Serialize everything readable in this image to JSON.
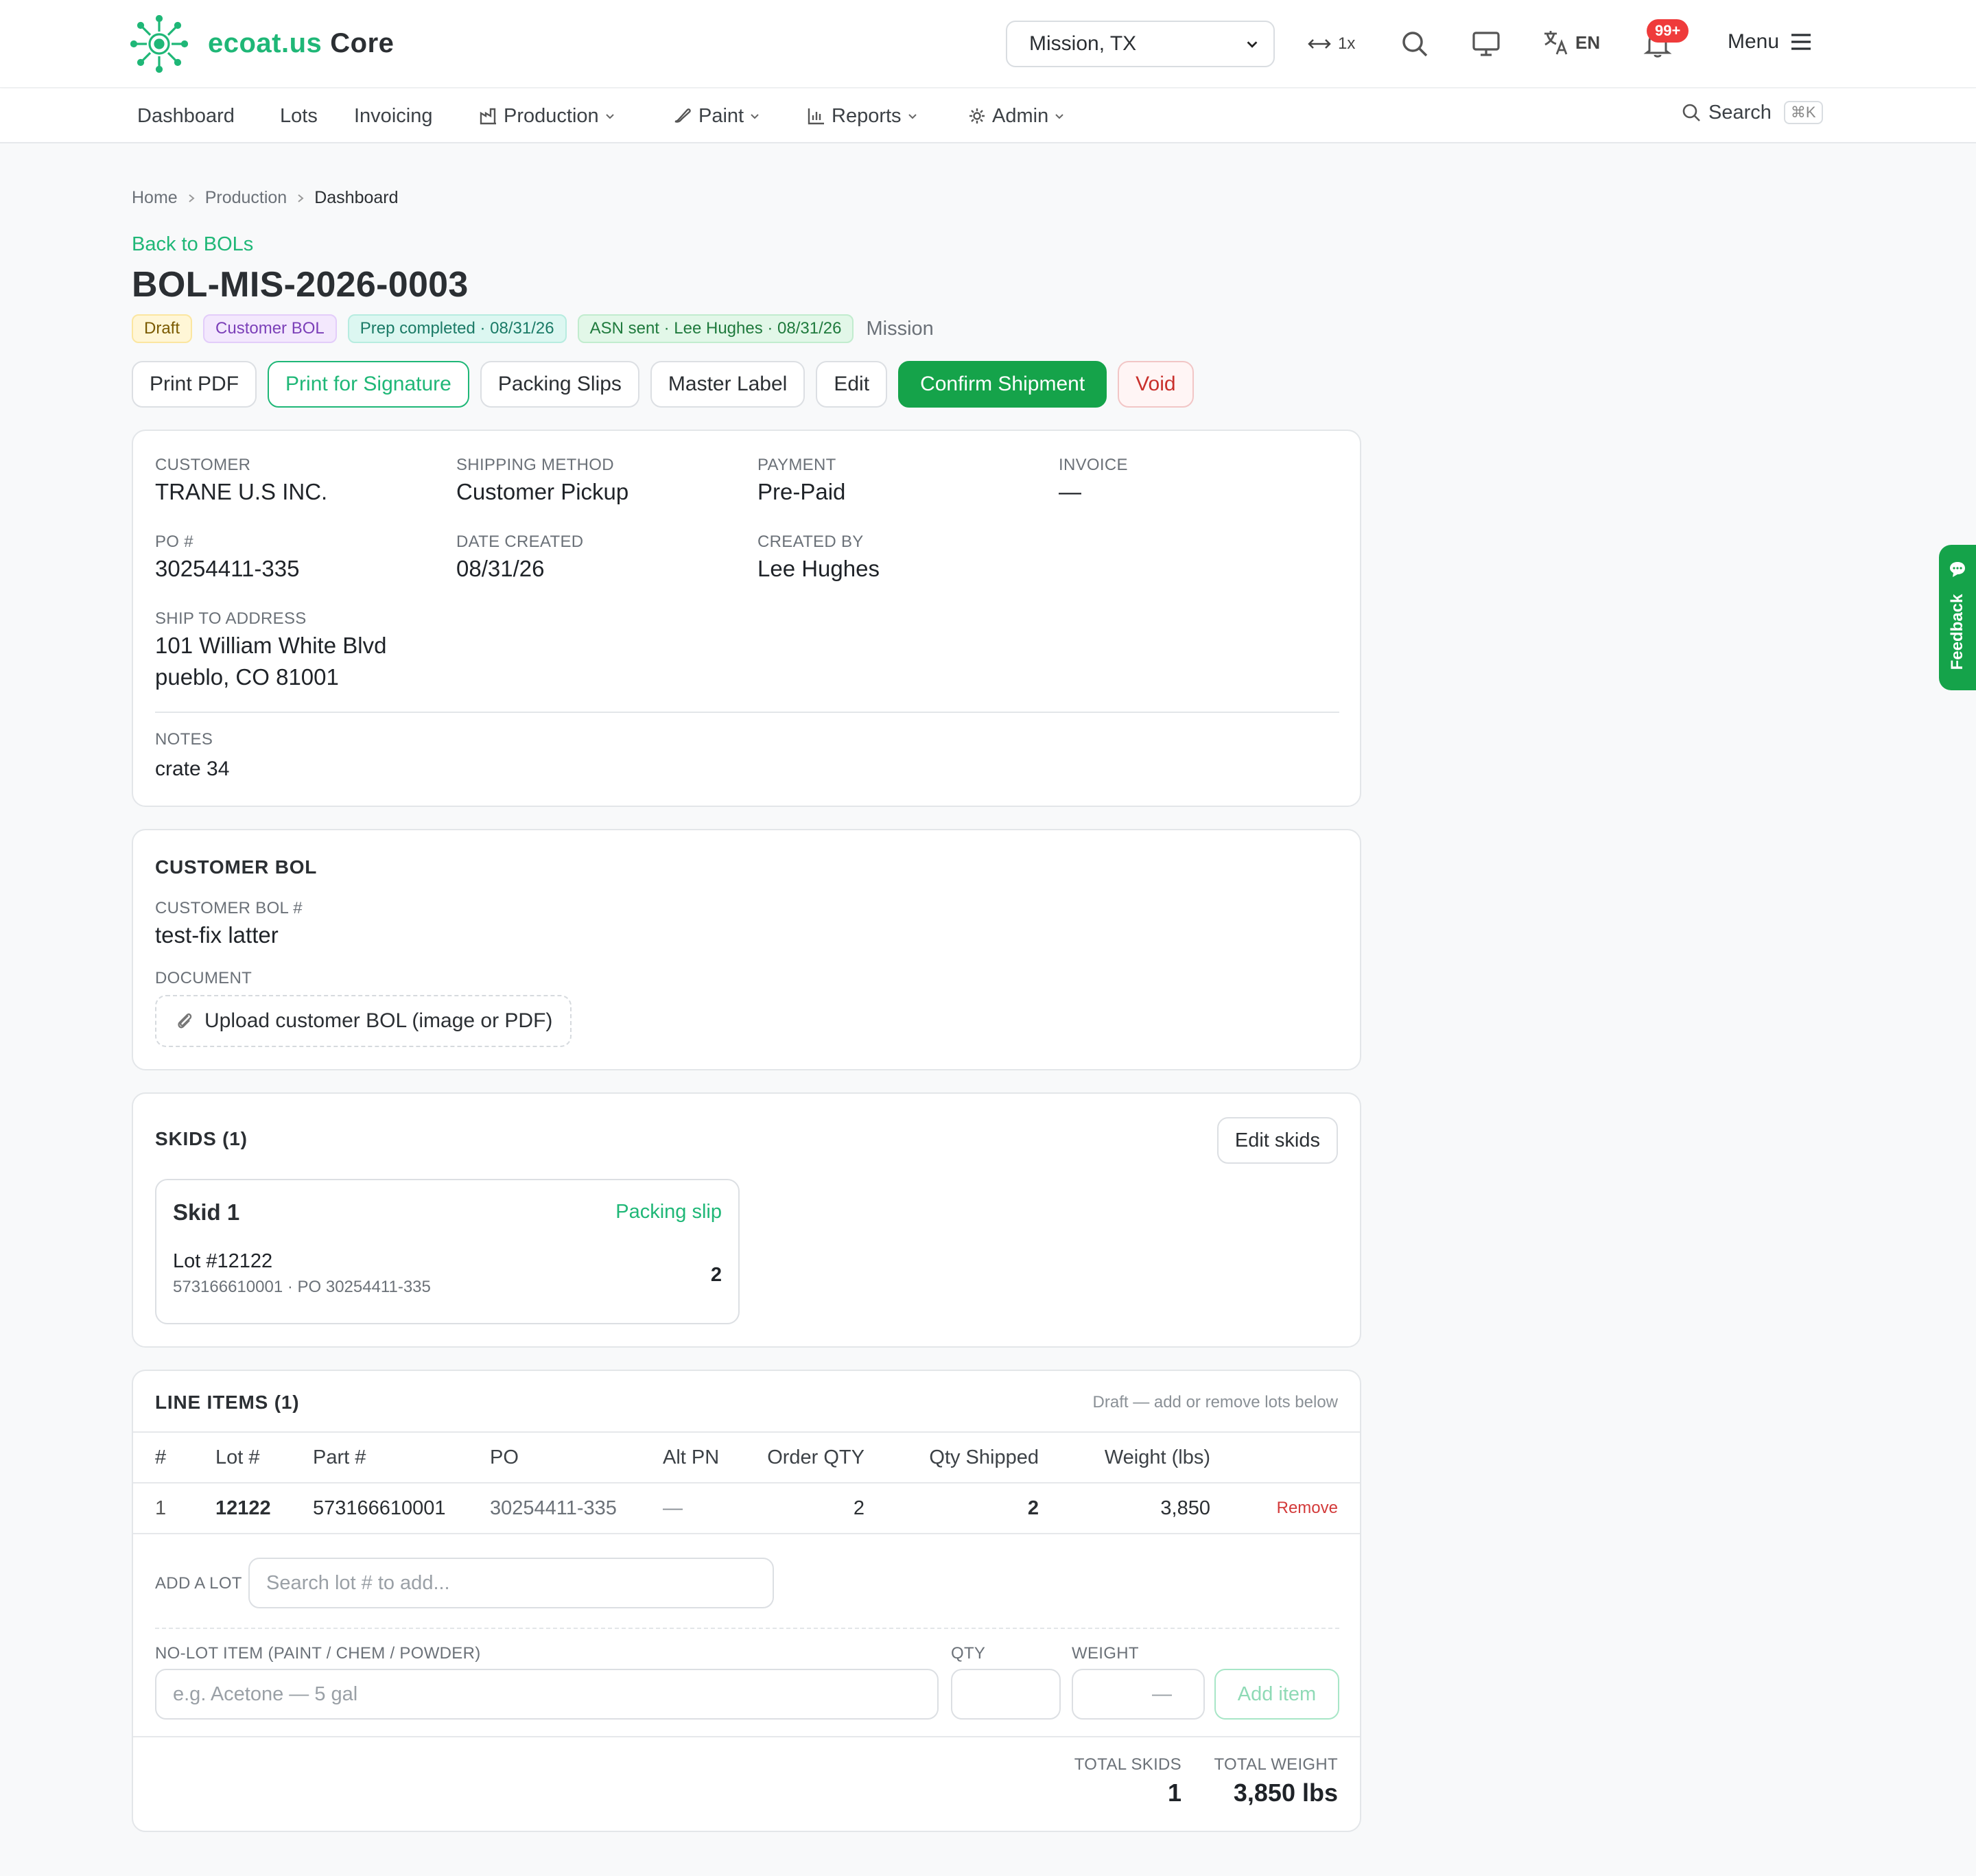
{
  "header": {
    "brand_accent": "ecoat.us",
    "brand_rest": "Core",
    "location": "Mission, TX",
    "zoom": "1x",
    "language": "EN",
    "notifications": "99+",
    "menu_label": "Menu",
    "colors": {
      "brand_green": "#1fb777",
      "action_green": "#15a34a",
      "alert_red": "#ef3b3b"
    }
  },
  "nav": {
    "items": [
      "Dashboard",
      "Lots",
      "Invoicing",
      "Production",
      "Paint",
      "Reports",
      "Admin"
    ],
    "search_label": "Search",
    "search_shortcut": "⌘K"
  },
  "breadcrumb": [
    "Home",
    "Production",
    "Dashboard"
  ],
  "back_link": "Back to BOLs",
  "title": "BOL-MIS-2026-0003",
  "badges": {
    "status": "Draft",
    "type": "Customer BOL",
    "prep": "Prep completed · 08/31/26",
    "asn": "ASN sent · Lee Hughes · 08/31/26",
    "site": "Mission"
  },
  "actions": [
    "Print PDF",
    "Print for Signature",
    "Packing Slips",
    "Master Label",
    "Edit",
    "Confirm Shipment",
    "Void"
  ],
  "details": {
    "customer_label": "CUSTOMER",
    "customer": "TRANE U.S INC.",
    "shipping_label": "SHIPPING METHOD",
    "shipping": "Customer Pickup",
    "payment_label": "PAYMENT",
    "payment": "Pre-Paid",
    "invoice_label": "INVOICE",
    "invoice": "—",
    "po_label": "PO #",
    "po": "30254411-335",
    "date_label": "DATE CREATED",
    "date": "08/31/26",
    "createdby_label": "CREATED BY",
    "createdby": "Lee Hughes",
    "shipto_label": "SHIP TO ADDRESS",
    "shipto_line1": "101 William White Blvd",
    "shipto_line2": "pueblo, CO 81001",
    "notes_label": "NOTES",
    "notes": "crate 34"
  },
  "customer_bol": {
    "title": "CUSTOMER BOL",
    "number_label": "CUSTOMER BOL #",
    "number": "test-fix latter",
    "document_label": "DOCUMENT",
    "upload_label": "Upload customer BOL (image or PDF)"
  },
  "skids": {
    "title": "SKIDS (1)",
    "edit_label": "Edit skids",
    "items": [
      {
        "name": "Skid 1",
        "link": "Packing slip",
        "lot": "Lot #12122",
        "sub": "573166610001 · PO 30254411-335",
        "qty": "2"
      }
    ]
  },
  "line_items": {
    "title": "LINE ITEMS (1)",
    "hint": "Draft — add or remove lots below",
    "columns": [
      "#",
      "Lot #",
      "Part #",
      "PO",
      "Alt PN",
      "Order QTY",
      "Qty Shipped",
      "Weight (lbs)"
    ],
    "rows": [
      {
        "n": "1",
        "lot": "12122",
        "part": "573166610001",
        "po": "30254411-335",
        "alt": "—",
        "order_qty": "2",
        "qty_shipped": "2",
        "weight": "3,850",
        "action": "Remove"
      }
    ],
    "add_lot_label": "ADD A LOT",
    "add_lot_placeholder": "Search lot # to add...",
    "nolot_label": "NO-LOT ITEM (PAINT / CHEM / POWDER)",
    "nolot_placeholder": "e.g. Acetone — 5 gal",
    "qty_label": "QTY",
    "weight_label": "WEIGHT",
    "weight_placeholder": "—",
    "add_item_label": "Add item",
    "total_skids_label": "TOTAL SKIDS",
    "total_skids": "1",
    "total_weight_label": "TOTAL WEIGHT",
    "total_weight": "3,850 lbs"
  },
  "feedback_label": "Feedback"
}
